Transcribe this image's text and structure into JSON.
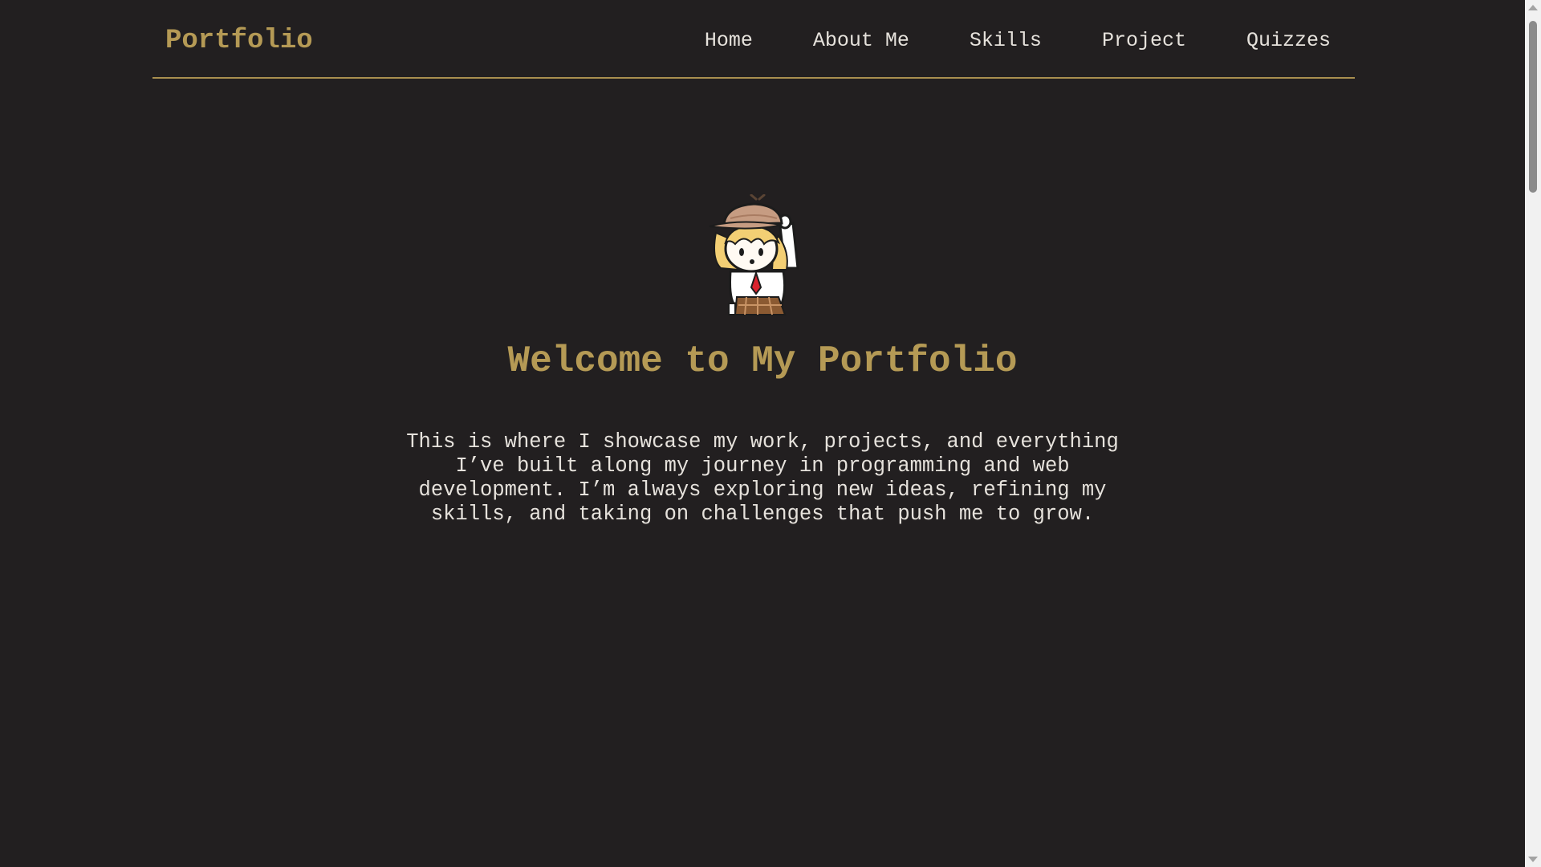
{
  "navbar": {
    "brand": "Portfolio",
    "links": [
      {
        "label": "Home"
      },
      {
        "label": "About Me"
      },
      {
        "label": "Skills"
      },
      {
        "label": "Project"
      },
      {
        "label": "Quizzes"
      }
    ]
  },
  "hero": {
    "mascot_icon": "detective-girl-waving-icon",
    "title": "Welcome to My Portfolio",
    "text": "This is where I showcase my work, projects, and everything I’ve built along my journey in programming and web development. I’m always exploring new ideas, refining my skills, and taking on challenges that push me to grow."
  },
  "colors": {
    "background": "#221f20",
    "accent": "#b59a55",
    "text": "#e6e2dc",
    "divider": "#a98f4f"
  }
}
